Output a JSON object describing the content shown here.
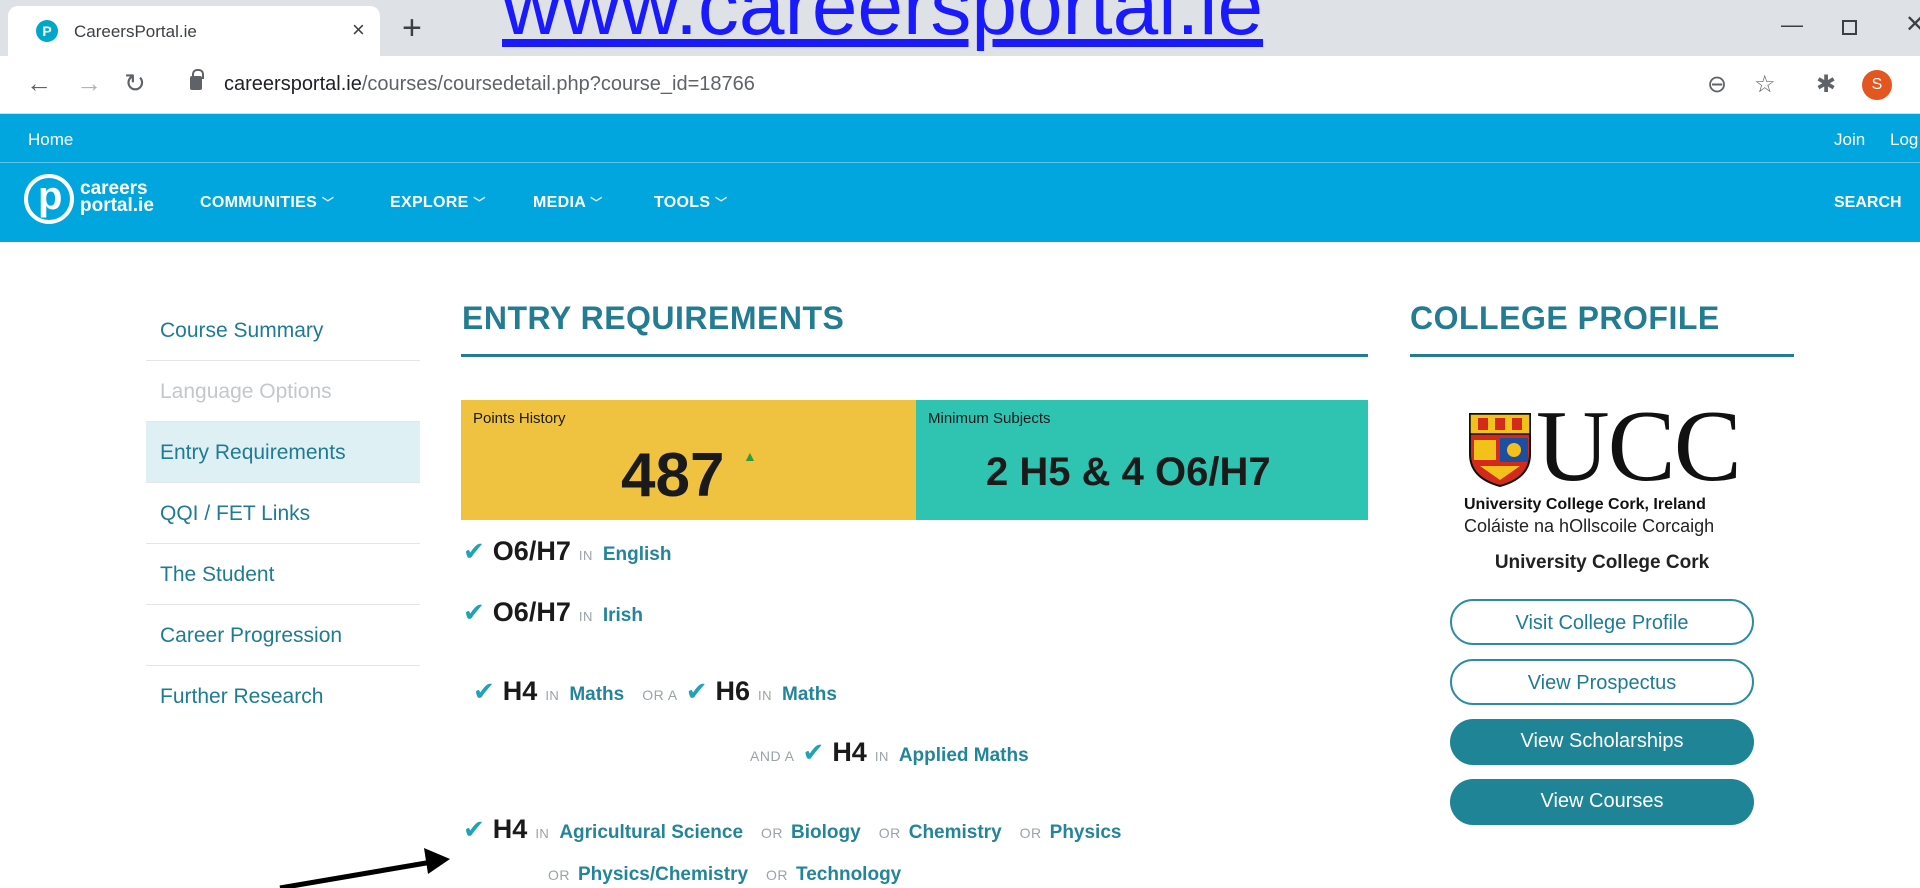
{
  "browser": {
    "tab_title": "CareersPortal.ie",
    "favicon_letter": "P",
    "tab_close": "×",
    "new_tab": "+",
    "url_domain": "careersportal.ie",
    "url_path": "/courses/coursedetail.php?course_id=18766",
    "avatar_letter": "S",
    "overlay_url": "www.careersportal.ie"
  },
  "header": {
    "home": "Home",
    "join": "Join",
    "login": "Log",
    "logo_line1": "careers",
    "logo_line2": "portal.ie",
    "nav": [
      "COMMUNITIES",
      "EXPLORE",
      "MEDIA",
      "TOOLS"
    ],
    "search": "SEARCH"
  },
  "sidebar": {
    "items": [
      {
        "label": "Course Summary",
        "state": "normal"
      },
      {
        "label": "Language Options",
        "state": "disabled"
      },
      {
        "label": "Entry Requirements",
        "state": "active"
      },
      {
        "label": "QQI / FET Links",
        "state": "normal"
      },
      {
        "label": "The Student",
        "state": "normal"
      },
      {
        "label": "Career Progression",
        "state": "normal"
      },
      {
        "label": "Further Research",
        "state": "normal"
      }
    ]
  },
  "entry": {
    "title": "ENTRY REQUIREMENTS",
    "points_label": "Points History",
    "points_value": "487",
    "points_trend": "▲",
    "subjects_label": "Minimum Subjects",
    "subjects_value": "2 H5 & 4 O6/H7",
    "in": "IN",
    "req1": {
      "grade": "O6/H7",
      "subject": "English"
    },
    "req2": {
      "grade": "O6/H7",
      "subject": "Irish"
    },
    "req3": {
      "grade1": "H4",
      "subject1": "Maths",
      "conj": "OR A",
      "grade2": "H6",
      "subject2": "Maths"
    },
    "req4": {
      "conj": "AND A",
      "grade": "H4",
      "subject": "Applied Maths"
    },
    "req5": {
      "grade": "H4",
      "or": "OR",
      "subjects": [
        "Agricultural Science",
        "Biology",
        "Chemistry",
        "Physics",
        "Physics/Chemistry",
        "Technology"
      ]
    }
  },
  "college": {
    "title": "COLLEGE PROFILE",
    "logo_letters": "UCC",
    "logo_en": "University College Cork, Ireland",
    "logo_ga": "Coláiste na hOllscoile Corcaigh",
    "name": "University College Cork",
    "buttons": [
      "Visit College Profile",
      "View Prospectus",
      "View Scholarships",
      "View Courses"
    ]
  },
  "colors": {
    "header_blue": "#00a6dd",
    "accent_teal": "#237c91",
    "points_yellow": "#efc23f",
    "subjects_teal": "#2fc3b2"
  }
}
